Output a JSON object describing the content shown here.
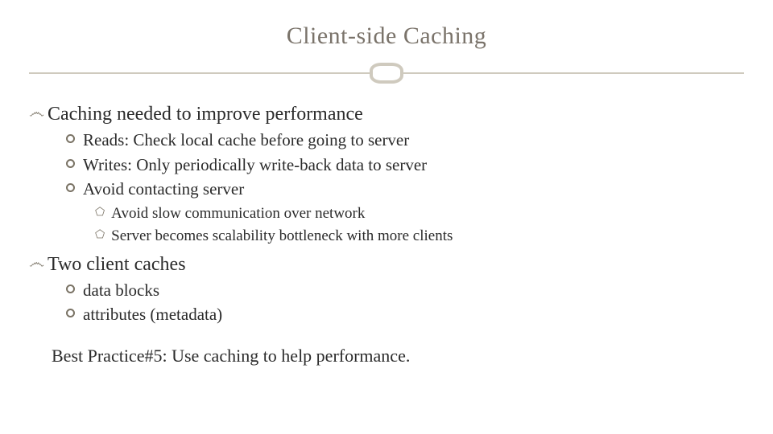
{
  "title": "Client-side Caching",
  "bullets": {
    "lvl1": [
      {
        "text": "Caching needed to improve performance"
      },
      {
        "text": "Two client caches"
      }
    ],
    "section1_lvl2": [
      {
        "text": "Reads: Check local cache before going to server"
      },
      {
        "text": "Writes: Only periodically write-back data to server"
      },
      {
        "text": "Avoid contacting server"
      }
    ],
    "section1_lvl3": [
      {
        "text": "Avoid slow communication over network"
      },
      {
        "text": "Server becomes scalability bottleneck with more clients"
      }
    ],
    "section2_lvl2": [
      {
        "text": "data blocks"
      },
      {
        "text": "attributes (metadata)"
      }
    ]
  },
  "bestpractice": "Best Practice#5: Use caching to help performance.",
  "glyphs": {
    "swirl": "෴",
    "check": "⬠"
  }
}
